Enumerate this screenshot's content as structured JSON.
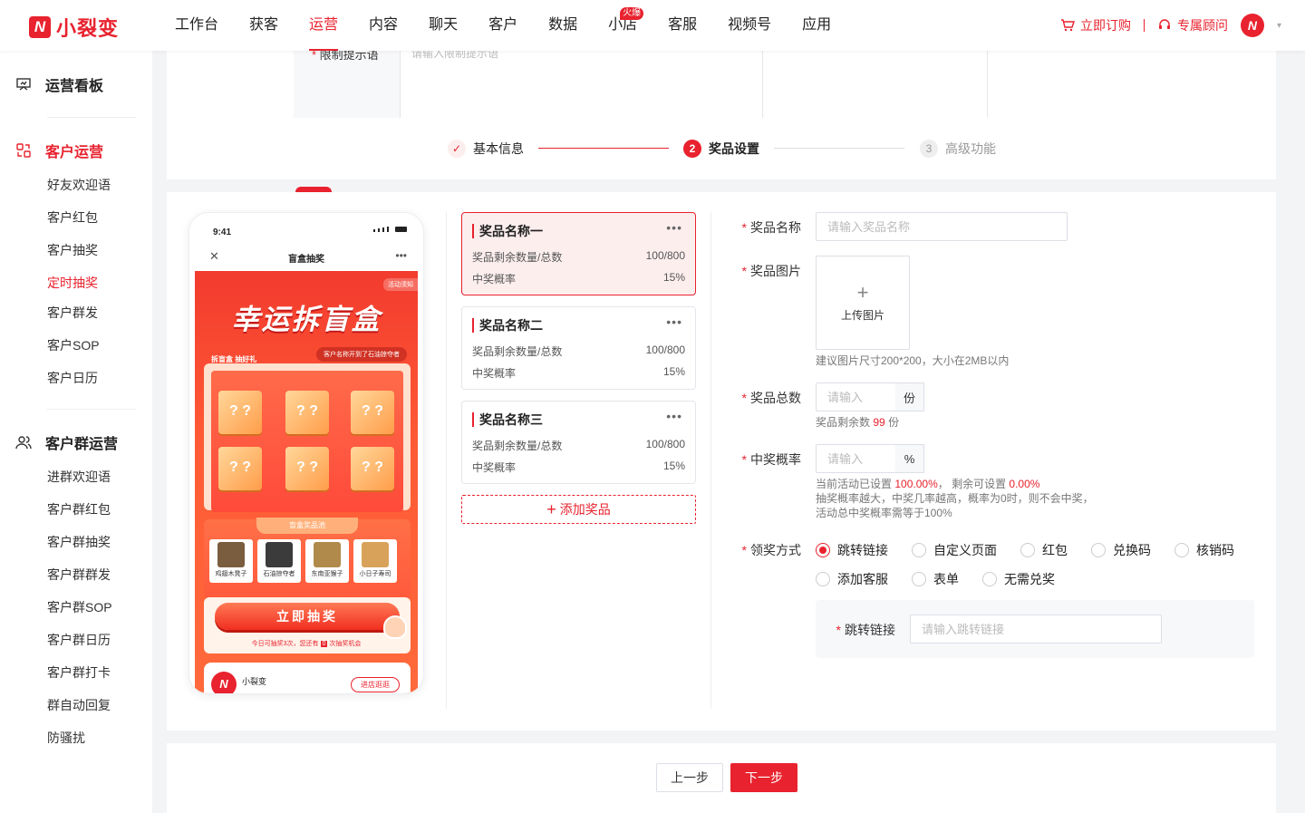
{
  "brand": {
    "logo_text": "小裂变",
    "accent": "#e8222e"
  },
  "nav": {
    "items": [
      {
        "label": "工作台"
      },
      {
        "label": "获客"
      },
      {
        "label": "运营",
        "active": true
      },
      {
        "label": "内容"
      },
      {
        "label": "聊天"
      },
      {
        "label": "客户"
      },
      {
        "label": "数据"
      },
      {
        "label": "小店",
        "badge": "火爆"
      },
      {
        "label": "客服"
      },
      {
        "label": "视频号"
      },
      {
        "label": "应用"
      }
    ],
    "order_label": "立即订购",
    "consultant_label": "专属顾问"
  },
  "sidebar": {
    "dashboard": "运营看板",
    "customer_ops": {
      "title": "客户运营",
      "items": [
        "好友欢迎语",
        "客户红包",
        "客户抽奖",
        "定时抽奖",
        "客户群发",
        "客户SOP",
        "客户日历"
      ],
      "active_index": 3
    },
    "group_ops": {
      "title": "客户群运营",
      "items": [
        "进群欢迎语",
        "客户群红包",
        "客户群抽奖",
        "客户群群发",
        "客户群SOP",
        "客户群日历",
        "客户群打卡",
        "群自动回复",
        "防骚扰"
      ]
    }
  },
  "top_partial": {
    "label": "限制提示语",
    "placeholder": "请输入限制提示语"
  },
  "steps": [
    {
      "label": "基本信息",
      "state": "done"
    },
    {
      "label": "奖品设置",
      "state": "active",
      "index": "2"
    },
    {
      "label": "高级功能",
      "state": "pending",
      "index": "3"
    }
  ],
  "phone": {
    "time": "9:41",
    "title": "盲盒抽奖",
    "rule": "活动须知",
    "hero": "幸运拆盲盒",
    "tag": "拆盲盒 抽好礼",
    "ticker": "客户名称开到了石油掠夺者",
    "box_mark": "? ?",
    "pool_title": "盲盒奖品池",
    "pool": [
      "鸡翅木凳子",
      "石油掠夺者",
      "东南亚猴子",
      "小日子寿司"
    ],
    "draw_button": "立即抽奖",
    "note_prefix": "今日可抽奖3次，您还有",
    "note_count": "0",
    "note_suffix": "次抽奖机会",
    "shop_name": "小裂变",
    "shop_button": "进店逛逛"
  },
  "prizes": [
    {
      "name": "奖品名称一",
      "stock_label": "奖品剩余数量/总数",
      "stock": "100/800",
      "rate_label": "中奖概率",
      "rate": "15%",
      "active": true
    },
    {
      "name": "奖品名称二",
      "stock_label": "奖品剩余数量/总数",
      "stock": "100/800",
      "rate_label": "中奖概率",
      "rate": "15%"
    },
    {
      "name": "奖品名称三",
      "stock_label": "奖品剩余数量/总数",
      "stock": "100/800",
      "rate_label": "中奖概率",
      "rate": "15%"
    }
  ],
  "add_prize": "添加奖品",
  "form": {
    "name_label": "奖品名称",
    "name_placeholder": "请输入奖品名称",
    "image_label": "奖品图片",
    "upload_label": "上传图片",
    "image_hint": "建议图片尺寸200*200，大小在2MB以内",
    "total_label": "奖品总数",
    "total_placeholder": "请输入",
    "total_unit": "份",
    "remaining_prefix": "奖品剩余数",
    "remaining_value": "99",
    "remaining_unit": "份",
    "rate_label": "中奖概率",
    "rate_placeholder": "请输入",
    "rate_unit": "%",
    "rate_hint_1a": "当前活动已设置",
    "rate_hint_1b": "100.00%",
    "rate_hint_1c": "，  剩余可设置",
    "rate_hint_1d": "0.00%",
    "rate_hint_2": "抽奖概率越大，中奖几率越高，概率为0时，则不会中奖，",
    "rate_hint_3": "活动总中奖概率需等于100%",
    "claim_label": "领奖方式",
    "claim_options_row1": [
      "跳转链接",
      "自定义页面",
      "红包",
      "兑换码",
      "核销码"
    ],
    "claim_options_row2": [
      "添加客服",
      "表单",
      "无需兑奖"
    ],
    "claim_selected": "跳转链接",
    "link_label": "跳转链接",
    "link_placeholder": "请输入跳转链接"
  },
  "footer": {
    "prev": "上一步",
    "next": "下一步"
  }
}
